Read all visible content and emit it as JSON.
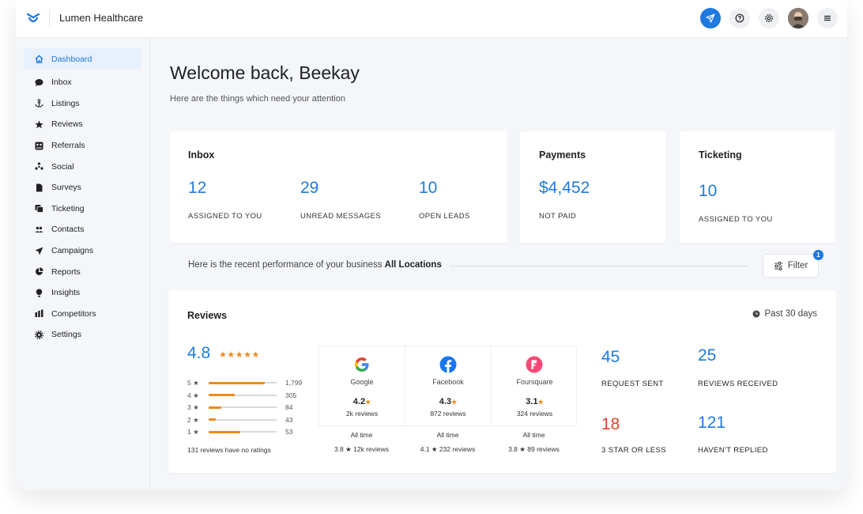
{
  "app": {
    "brand_name": "Lumen Healthcare"
  },
  "topbar": {
    "icons": [
      "send-icon",
      "help-icon",
      "settings-icon",
      "avatar",
      "menu-icon"
    ]
  },
  "sidebar": {
    "items": [
      {
        "label": "Dashboard",
        "icon": "home-icon",
        "active": true
      },
      {
        "label": "Inbox",
        "icon": "chat-icon"
      },
      {
        "label": "Listings",
        "icon": "anchor-icon"
      },
      {
        "label": "Reviews",
        "icon": "star-icon"
      },
      {
        "label": "Referrals",
        "icon": "referral-icon"
      },
      {
        "label": "Social",
        "icon": "social-icon"
      },
      {
        "label": "Surveys",
        "icon": "document-icon"
      },
      {
        "label": "Ticketing",
        "icon": "ticket-icon"
      },
      {
        "label": "Contacts",
        "icon": "contacts-icon"
      },
      {
        "label": "Campaigns",
        "icon": "send-icon"
      },
      {
        "label": "Reports",
        "icon": "pie-chart-icon"
      },
      {
        "label": "Insights",
        "icon": "bulb-icon"
      },
      {
        "label": "Competitors",
        "icon": "bar-chart-icon"
      },
      {
        "label": "Settings",
        "icon": "gear-icon"
      }
    ]
  },
  "welcome": {
    "title": "Welcome back, Beekay",
    "subtitle": "Here are the things which need your attention"
  },
  "inbox_card": {
    "title": "Inbox",
    "metrics": [
      {
        "value": "12",
        "label": "ASSIGNED TO YOU"
      },
      {
        "value": "29",
        "label": "UNREAD MESSAGES"
      },
      {
        "value": "10",
        "label": "OPEN LEADS"
      }
    ]
  },
  "payments_card": {
    "title": "Payments",
    "value": "$4,452",
    "label": "NOT PAID"
  },
  "ticketing_card": {
    "title": "Ticketing",
    "value": "10",
    "label": "ASSIGNED TO YOU"
  },
  "performance": {
    "text": "Here is the recent performance of your business",
    "location": "All Locations",
    "filter_label": "Filter",
    "filter_count": "1"
  },
  "reviews": {
    "title": "Reviews",
    "period": "Past 30 days",
    "average": "4.8",
    "stars": "★★★★★",
    "distribution": [
      {
        "label": "5 ★",
        "count": "1,799",
        "fraction": 0.83
      },
      {
        "label": "4 ★",
        "count": "305",
        "fraction": 0.38
      },
      {
        "label": "3 ★",
        "count": "84",
        "fraction": 0.19
      },
      {
        "label": "2 ★",
        "count": "43",
        "fraction": 0.1
      },
      {
        "label": "1 ★",
        "count": "53",
        "fraction": 0.46
      }
    ],
    "no_ratings_text": "131 reviews have no ratings",
    "sources": [
      {
        "name": "Google",
        "rating": "4.2",
        "count": "2k reviews",
        "all_time_label": "All time",
        "all_time": "3.8 ★ 12k reviews",
        "color": "#4285f4",
        "icon": "google-icon"
      },
      {
        "name": "Facebook",
        "rating": "4.3",
        "count": "872 reviews",
        "all_time_label": "All time",
        "all_time": "4.1 ★ 232 reviews",
        "color": "#1877f2",
        "icon": "facebook-icon"
      },
      {
        "name": "Foursquare",
        "rating": "3.1",
        "count": "324 reviews",
        "all_time_label": "All time",
        "all_time": "3.8 ★ 89 reviews",
        "color": "#f94877",
        "icon": "foursquare-icon"
      }
    ],
    "star_glyph": "★",
    "stats": [
      {
        "value": "45",
        "label": "REQUEST SENT",
        "color": "#1f7ae0"
      },
      {
        "value": "25",
        "label": "REVIEWS RECEIVED",
        "color": "#1f7ae0"
      },
      {
        "value": "18",
        "label": "3 STAR OR LESS",
        "color": "#e0452b"
      },
      {
        "value": "121",
        "label": "HAVEN'T REPLIED",
        "color": "#1f7ae0"
      }
    ]
  },
  "colors": {
    "accent": "#1f7ae0",
    "star": "#f08a1c",
    "warning": "#e0452b"
  }
}
